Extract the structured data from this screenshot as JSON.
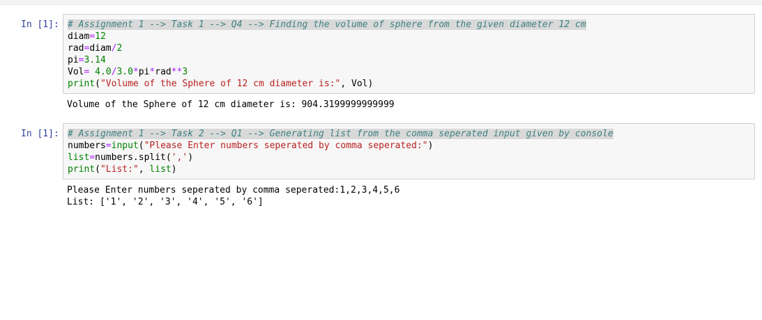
{
  "cells": [
    {
      "prompt": "In [1]:",
      "code": {
        "l1": "# Assignment 1 --> Task 1 --> Q4 --> Finding the volume of sphere from the given diameter 12 cm",
        "l2": {
          "var": "diam",
          "op": "=",
          "num": "12"
        },
        "l3": {
          "var": "rad",
          "op1": "=",
          "var2": "diam",
          "op2": "/",
          "num": "2"
        },
        "l4": {
          "var": "pi",
          "op": "=",
          "num": "3.14"
        },
        "l5": {
          "var": "Vol",
          "op1": "=",
          "sp": " ",
          "num1": "4.0",
          "op2": "/",
          "num2": "3.0",
          "op3": "*",
          "var2": "pi",
          "op4": "*",
          "var3": "rad",
          "op5": "**",
          "num3": "3"
        },
        "l6": {
          "fn": "print",
          "open": "(",
          "str": "\"Volume of the Sphere of 12 cm diameter is:\"",
          "rest": ", Vol)"
        }
      },
      "output": [
        "Volume of the Sphere of 12 cm diameter is: 904.3199999999999"
      ]
    },
    {
      "prompt": "In [1]:",
      "code": {
        "l1": "# Assignment 1 --> Task 2 --> Q1 --> Generating list from the comma seperated input given by console",
        "l2": {
          "var": "numbers",
          "op": "=",
          "fn": "input",
          "open": "(",
          "str": "\"Please Enter numbers seperated by comma seperated:\"",
          "close": ")"
        },
        "l3": {
          "var": "list",
          "op": "=",
          "rest1": "numbers.split(",
          "str": "','",
          "close": ")"
        },
        "l4": {
          "fn": "print",
          "open": "(",
          "str": "\"List:\"",
          "rest": ", ",
          "var": "list",
          "close": ")"
        }
      },
      "output": [
        "Please Enter numbers seperated by comma seperated:1,2,3,4,5,6",
        "List: ['1', '2', '3', '4', '5', '6']"
      ]
    }
  ]
}
